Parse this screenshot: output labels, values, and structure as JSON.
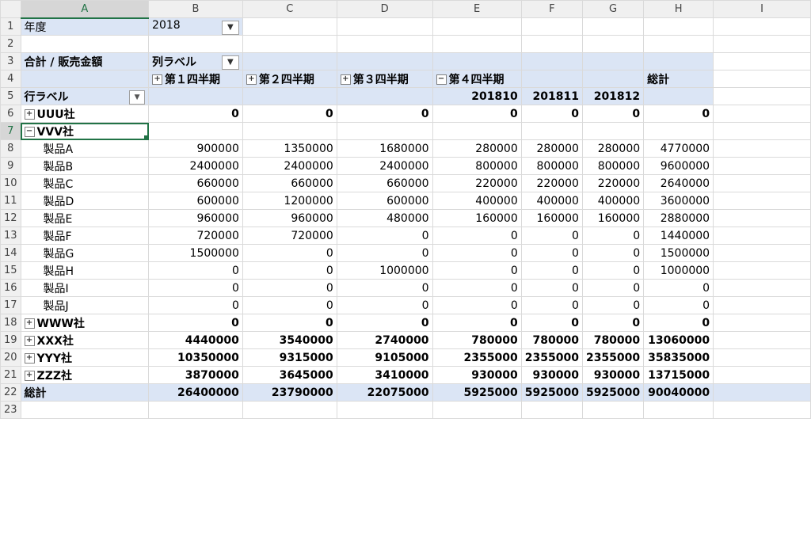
{
  "columns": [
    "A",
    "B",
    "C",
    "D",
    "E",
    "F",
    "G",
    "H",
    "I"
  ],
  "filter": {
    "label": "年度",
    "value": "2018"
  },
  "pivot": {
    "title": "合計 / 販売金額",
    "col_label": "列ラベル",
    "row_label": "行ラベル",
    "quarters": [
      "第１四半期",
      "第２四半期",
      "第３四半期",
      "第４四半期"
    ],
    "months": [
      "201810",
      "201811",
      "201812"
    ],
    "grand_total_label": "総計"
  },
  "rows": [
    {
      "num": "6",
      "label": "UUU社",
      "type": "company",
      "pm": "⊞",
      "values": [
        "0",
        "0",
        "0",
        "0",
        "0",
        "0",
        "0"
      ]
    },
    {
      "num": "7",
      "label": "VVV社",
      "type": "company",
      "pm": "⊟",
      "values": [
        "",
        "",
        "",
        "",
        "",
        "",
        ""
      ]
    },
    {
      "num": "8",
      "label": "製品A",
      "type": "product",
      "values": [
        "900000",
        "1350000",
        "1680000",
        "280000",
        "280000",
        "280000",
        "4770000"
      ]
    },
    {
      "num": "9",
      "label": "製品B",
      "type": "product",
      "values": [
        "2400000",
        "2400000",
        "2400000",
        "800000",
        "800000",
        "800000",
        "9600000"
      ]
    },
    {
      "num": "10",
      "label": "製品C",
      "type": "product",
      "values": [
        "660000",
        "660000",
        "660000",
        "220000",
        "220000",
        "220000",
        "2640000"
      ]
    },
    {
      "num": "11",
      "label": "製品D",
      "type": "product",
      "values": [
        "600000",
        "1200000",
        "600000",
        "400000",
        "400000",
        "400000",
        "3600000"
      ]
    },
    {
      "num": "12",
      "label": "製品E",
      "type": "product",
      "values": [
        "960000",
        "960000",
        "480000",
        "160000",
        "160000",
        "160000",
        "2880000"
      ]
    },
    {
      "num": "13",
      "label": "製品F",
      "type": "product",
      "values": [
        "720000",
        "720000",
        "0",
        "0",
        "0",
        "0",
        "1440000"
      ]
    },
    {
      "num": "14",
      "label": "製品G",
      "type": "product",
      "values": [
        "1500000",
        "0",
        "0",
        "0",
        "0",
        "0",
        "1500000"
      ]
    },
    {
      "num": "15",
      "label": "製品H",
      "type": "product",
      "values": [
        "0",
        "0",
        "1000000",
        "0",
        "0",
        "0",
        "1000000"
      ]
    },
    {
      "num": "16",
      "label": "製品I",
      "type": "product",
      "values": [
        "0",
        "0",
        "0",
        "0",
        "0",
        "0",
        "0"
      ]
    },
    {
      "num": "17",
      "label": "製品J",
      "type": "product",
      "values": [
        "0",
        "0",
        "0",
        "0",
        "0",
        "0",
        "0"
      ]
    },
    {
      "num": "18",
      "label": "WWW社",
      "type": "company",
      "pm": "⊞",
      "values": [
        "0",
        "0",
        "0",
        "0",
        "0",
        "0",
        "0"
      ]
    },
    {
      "num": "19",
      "label": "XXX社",
      "type": "company",
      "pm": "⊞",
      "values": [
        "4440000",
        "3540000",
        "2740000",
        "780000",
        "780000",
        "780000",
        "13060000"
      ]
    },
    {
      "num": "20",
      "label": "YYY社",
      "type": "company",
      "pm": "⊞",
      "values": [
        "10350000",
        "9315000",
        "9105000",
        "2355000",
        "2355000",
        "2355000",
        "35835000"
      ]
    },
    {
      "num": "21",
      "label": "ZZZ社",
      "type": "company",
      "pm": "⊞",
      "values": [
        "3870000",
        "3645000",
        "3410000",
        "930000",
        "930000",
        "930000",
        "13715000"
      ]
    }
  ],
  "total": {
    "num": "22",
    "label": "総計",
    "values": [
      "26400000",
      "23790000",
      "22075000",
      "5925000",
      "5925000",
      "5925000",
      "90040000"
    ]
  },
  "icons": {
    "filter": "filter-icon",
    "dropdown": "dropdown-icon",
    "expand": "expand-icon",
    "collapse": "collapse-icon"
  }
}
